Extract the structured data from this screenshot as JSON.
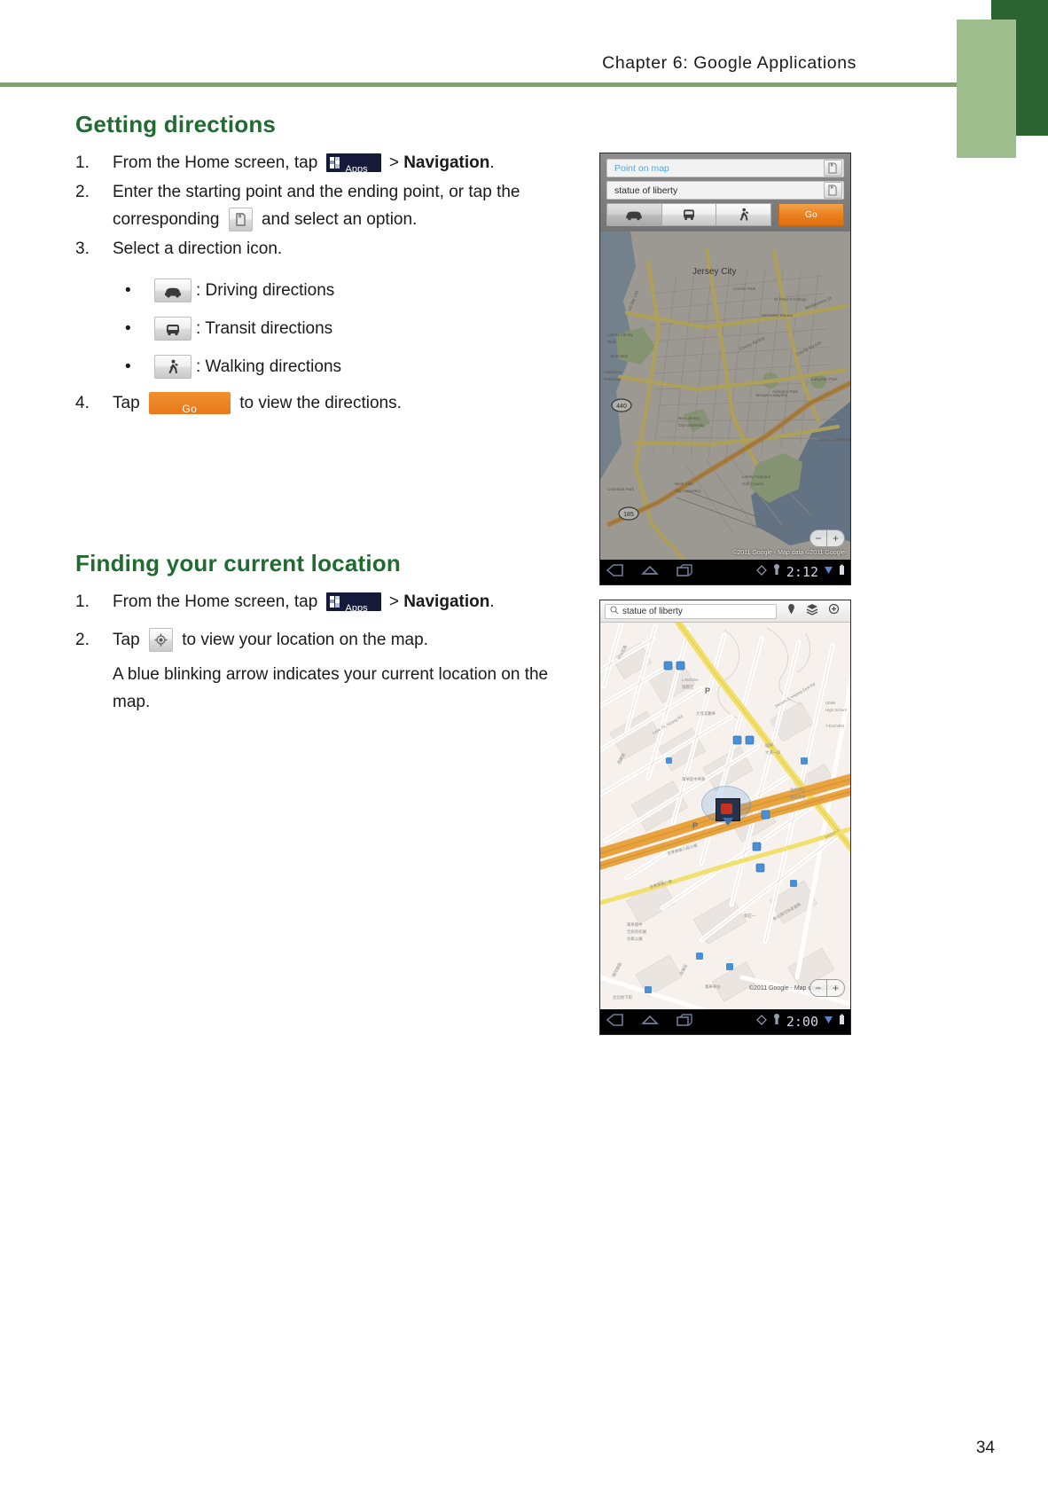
{
  "page": {
    "header_title": "Chapter 6: Google Applications",
    "page_number": "34",
    "accent_green": "#1f6b30",
    "rule_green": "#7fa468",
    "deco_dark_green": "#2b6431",
    "deco_light_green": "#9fbe8e",
    "orange": "#e8791a"
  },
  "sections": [
    {
      "heading": "Getting directions",
      "steps": [
        {
          "num": "1.",
          "pre": "From the Home screen, tap ",
          "icon": "apps-icon",
          "mid": " > ",
          "bold": "Navigation",
          "post": "."
        },
        {
          "num": "2.",
          "pre": "Enter the starting point and the ending point, or tap the corresponding ",
          "icon": "bookmark-icon",
          "post": " and select an option."
        },
        {
          "num": "3.",
          "pre": "Select a direction icon."
        },
        {
          "num": "4.",
          "pre": "Tap ",
          "icon": "go-button-icon",
          "post": " to view the directions."
        }
      ],
      "bullets": [
        {
          "icon": "car-icon",
          "label": ": Driving directions"
        },
        {
          "icon": "bus-icon",
          "label": ": Transit directions"
        },
        {
          "icon": "walk-icon",
          "label": ": Walking directions"
        }
      ]
    },
    {
      "heading": "Finding your current location",
      "steps": [
        {
          "num": "1.",
          "pre": "From the Home screen, tap ",
          "icon": "apps-icon",
          "mid": " > ",
          "bold": "Navigation",
          "post": "."
        },
        {
          "num": "2.",
          "pre": "Tap ",
          "icon": "my-location-icon",
          "post": " to view your location on the map."
        }
      ],
      "note": "A blue blinking arrow indicates your current location on the map."
    }
  ],
  "apps_chip": {
    "label": "Apps"
  },
  "go_chip": {
    "label": "Go"
  },
  "screenshot_navigation": {
    "name": "navigation-directions-screen",
    "start_field": {
      "value": "Point on map",
      "is_hint": true
    },
    "end_field": {
      "value": "statue of liberty",
      "is_hint": false
    },
    "modes": [
      {
        "name": "driving-mode",
        "icon": "car-icon",
        "active": true
      },
      {
        "name": "transit-mode",
        "icon": "bus-icon",
        "active": false
      },
      {
        "name": "walking-mode",
        "icon": "walk-icon",
        "active": false
      }
    ],
    "go_label": "Go",
    "map_label": "Jersey City",
    "map_labels": [
      "Jersey City",
      "Lincoln Park",
      "Montgomery St",
      "County Rd 622",
      "Bergen-Lafayette",
      "Liberty State Park",
      "New Jersey City University"
    ],
    "shield_labels": [
      "440",
      "185"
    ],
    "attribution": "©2011 Google - Map data ©2011 Google",
    "zoom_out": "−",
    "zoom_in": "+",
    "clock": "2:12",
    "nav_buttons": [
      "back-icon",
      "home-icon",
      "recent-apps-icon"
    ]
  },
  "screenshot_location": {
    "name": "current-location-screen",
    "search_value": "statue of liberty",
    "search_icon": "search-icon",
    "toolbar_icons": [
      "place-pin-icon",
      "layers-icon",
      "my-location-icon"
    ],
    "attribution": "©2011 Google - Map data ©2011...",
    "zoom_out": "−",
    "zoom_in": "+",
    "clock": "2:00",
    "parking_markers": [
      "P",
      "P"
    ],
    "nav_buttons": [
      "back-icon",
      "home-icon",
      "recent-apps-icon"
    ]
  }
}
